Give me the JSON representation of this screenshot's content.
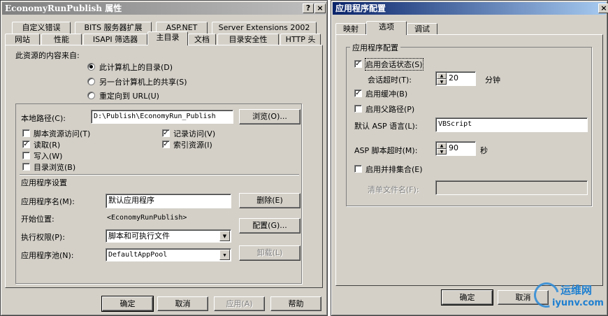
{
  "left_dialog": {
    "title": "EconomyRunPublish 属性",
    "help_glyph": "?",
    "close_glyph": "×",
    "tabs_row1": [
      "自定义错误",
      "BITS 服务器扩展",
      "ASP.NET",
      "Server Extensions 2002"
    ],
    "tabs_row2": [
      "网站",
      "性能",
      "ISAPI 筛选器",
      "主目录",
      "文档",
      "目录安全性",
      "HTTP 头"
    ],
    "content_source_label": "此资源的内容来自:",
    "radio_options": [
      "此计算机上的目录(D)",
      "另一台计算机上的共享(S)",
      "重定向到 URL(U)"
    ],
    "local_path_label": "本地路径(C):",
    "local_path_value": "D:\\Publish\\EconomyRun_Publish",
    "browse_button": "浏览(O)...",
    "checkboxes_left": [
      {
        "label": "脚本资源访问(T)",
        "checked": false
      },
      {
        "label": "读取(R)",
        "checked": true
      },
      {
        "label": "写入(W)",
        "checked": false
      },
      {
        "label": "目录浏览(B)",
        "checked": false
      }
    ],
    "checkboxes_right": [
      {
        "label": "记录访问(V)",
        "checked": true
      },
      {
        "label": "索引资源(I)",
        "checked": true
      }
    ],
    "app_settings_label": "应用程序设置",
    "app_name_label": "应用程序名(M):",
    "app_name_value": "默认应用程序",
    "remove_button": "删除(E)",
    "start_pos_label": "开始位置:",
    "start_pos_value": "<EconomyRunPublish>",
    "config_button": "配置(G)...",
    "exec_perm_label": "执行权限(P):",
    "exec_perm_value": "脚本和可执行文件",
    "app_pool_label": "应用程序池(N):",
    "app_pool_value": "DefaultAppPool",
    "unload_button": "卸载(L)",
    "footer_buttons": [
      "确定",
      "取消",
      "应用(A)",
      "帮助"
    ],
    "check_glyph": "✓",
    "dropdown_glyph": "▼"
  },
  "right_dialog": {
    "title": "应用程序配置",
    "close_glyph": "×",
    "tabs": [
      "映射",
      "选项",
      "调试"
    ],
    "group_label": "应用程序配置",
    "enable_session": {
      "label": "启用会话状态(S)",
      "checked": true
    },
    "session_timeout_label": "会话超时(T):",
    "session_timeout_value": "20",
    "session_timeout_unit": "分钟",
    "enable_buffer": {
      "label": "启用缓冲(B)",
      "checked": true
    },
    "enable_parent_path": {
      "label": "启用父路径(P)",
      "checked": false
    },
    "default_lang_label": "默认 ASP 语言(L):",
    "default_lang_value": "VBScript",
    "script_timeout_label": "ASP 脚本超时(M):",
    "script_timeout_value": "90",
    "script_timeout_unit": "秒",
    "enable_side_by_side": {
      "label": "启用并排集合(E)",
      "checked": false
    },
    "manifest_label": "清单文件名(F):",
    "manifest_value": "",
    "footer_buttons": [
      "确定",
      "取消"
    ],
    "spin_up": "▲",
    "spin_down": "▼"
  },
  "watermark": {
    "line1": "运维网",
    "line2": "iyunv.com",
    "color": "#1e7fd0"
  }
}
